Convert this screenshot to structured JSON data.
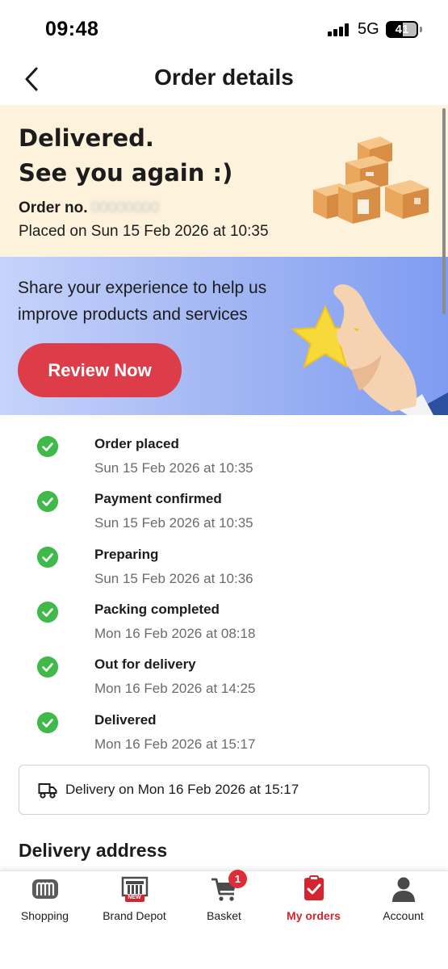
{
  "status_bar": {
    "time": "09:48",
    "network": "5G",
    "battery": "41"
  },
  "header": {
    "title": "Order details",
    "back_icon": "chevron-left-icon"
  },
  "status_banner": {
    "headline_1": "Delivered.",
    "headline_2": "See you again :)",
    "order_no_label": "Order no.",
    "order_no_value": "00000000",
    "placed_on": "Placed on Sun 15 Feb 2026 at 10:35",
    "colors": {
      "background": "#fdf3dc"
    }
  },
  "review_banner": {
    "text": "Share your experience to help us improve products and services",
    "button_label": "Review Now",
    "colors": {
      "button": "#dd3c49"
    }
  },
  "timeline": [
    {
      "title": "Order placed",
      "time": "Sun 15 Feb 2026 at 10:35",
      "icon": "check-circle-icon"
    },
    {
      "title": "Payment confirmed",
      "time": "Sun 15 Feb 2026 at 10:35",
      "icon": "check-circle-icon"
    },
    {
      "title": "Preparing",
      "time": "Sun 15 Feb 2026 at 10:36",
      "icon": "check-circle-icon"
    },
    {
      "title": "Packing completed",
      "time": "Mon 16 Feb 2026 at 08:18",
      "icon": "check-circle-icon"
    },
    {
      "title": "Out for delivery",
      "time": "Mon 16 Feb 2026 at 14:25",
      "icon": "check-circle-icon"
    },
    {
      "title": "Delivered",
      "time": "Mon 16 Feb 2026 at 15:17",
      "icon": "check-circle-icon"
    }
  ],
  "delivery": {
    "text": "Delivery on Mon 16 Feb 2026 at 15:17",
    "icon": "truck-icon"
  },
  "sections": {
    "delivery_address": "Delivery address"
  },
  "tab_bar": {
    "tabs": [
      {
        "label": "Shopping",
        "icon": "m-logo-icon",
        "active": false
      },
      {
        "label": "Brand Depot",
        "icon": "brand-depot-icon",
        "active": false
      },
      {
        "label": "Basket",
        "icon": "cart-icon",
        "active": false
      },
      {
        "label": "My orders",
        "icon": "orders-icon",
        "active": true
      },
      {
        "label": "Account",
        "icon": "person-icon",
        "active": false
      }
    ],
    "basket_badge": "1",
    "brand_depot_tag": "NEW",
    "colors": {
      "active": "#d4252f",
      "badge": "#dd2d36"
    }
  }
}
